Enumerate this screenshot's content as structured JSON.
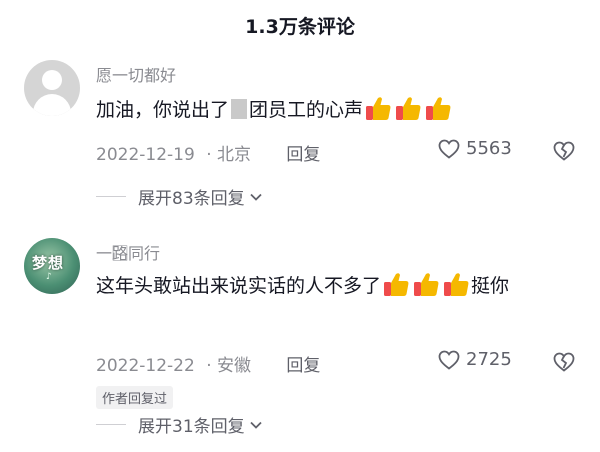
{
  "header": {
    "title": "1.3万条评论"
  },
  "comments": [
    {
      "avatar": "default-avatar",
      "username": "愿一切都好",
      "text_before": "加油，你说出了",
      "text_after": "团员工的心声",
      "reactions": [
        "thumbs-up",
        "thumbs-up",
        "thumbs-up"
      ],
      "date": "2022-12-19",
      "location": "· 北京",
      "reply_label": "回复",
      "likes": "5563",
      "expand_label": "展开83条回复"
    },
    {
      "avatar": "dream-avatar",
      "avatar_text": "梦想",
      "avatar_sub": "♪",
      "username": "一路⃞同行",
      "text_before": "这年头敢站出来说实话的人不多了",
      "text_after": "挺你",
      "reactions": [
        "thumbs-up",
        "thumbs-up",
        "thumbs-up"
      ],
      "date": "2022-12-22",
      "location": "· 安徽",
      "reply_label": "回复",
      "likes": "2725",
      "author_badge": "作者回复过",
      "expand_label": "展开31条回复"
    }
  ],
  "colors": {
    "text": "#161823",
    "secondary": "#8a8b91",
    "thumb": "#f5b800",
    "thumb_cuff": "#ef4b4b"
  }
}
